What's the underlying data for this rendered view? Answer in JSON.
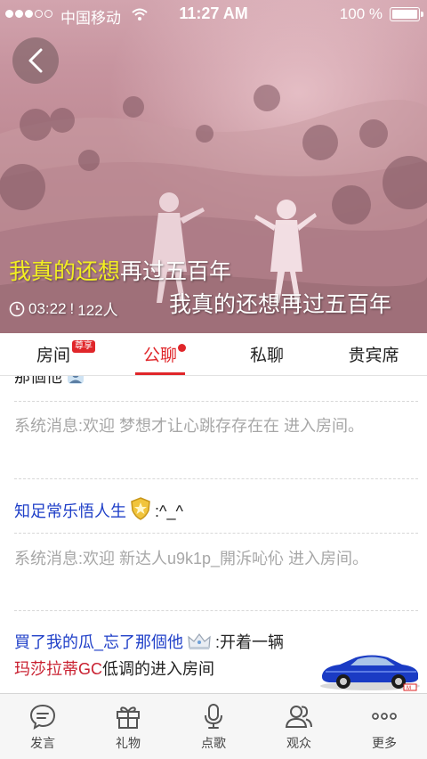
{
  "status_bar": {
    "carrier": "中国移动",
    "time": "11:27 AM",
    "battery": "100 %"
  },
  "hero": {
    "title_highlight": "我真的还想",
    "title_rest": "再过五百年",
    "duration": "03:22",
    "separator": "!",
    "audience": "122人",
    "scrolling_lyric": "我真的还想再过五百年"
  },
  "tabs": [
    {
      "label": "房间",
      "badge": "尊享"
    },
    {
      "label": "公聊",
      "active": true
    },
    {
      "label": "私聊"
    },
    {
      "label": "贵宾席"
    }
  ],
  "chat": {
    "partial_top": "那個他",
    "messages": [
      {
        "type": "system",
        "text": "系统消息:欢迎  梦想才让心跳存存在在  进入房间。"
      },
      {
        "type": "user",
        "name": "知足常乐悟人生",
        "content": ":^_^"
      },
      {
        "type": "system",
        "text": "系统消息:欢迎  新达人u9k1p_開泝吣伈  进入房间。"
      },
      {
        "type": "user",
        "name": "買了我的瓜_忘了那個他",
        "content": ":开着一辆"
      },
      {
        "type": "entry",
        "name": "玛莎拉蒂GC",
        "content": "低调的进入房间"
      }
    ]
  },
  "bottom_nav": [
    {
      "label": "发言",
      "icon": "chat-bubble-icon"
    },
    {
      "label": "礼物",
      "icon": "gift-icon"
    },
    {
      "label": "点歌",
      "icon": "microphone-icon"
    },
    {
      "label": "观众",
      "icon": "audience-icon"
    },
    {
      "label": "更多",
      "icon": "more-icon"
    }
  ],
  "colors": {
    "accent": "#e0262a",
    "username": "#1f3fc8",
    "system_text": "#a7a7a7",
    "highlight": "#f2ee22"
  }
}
